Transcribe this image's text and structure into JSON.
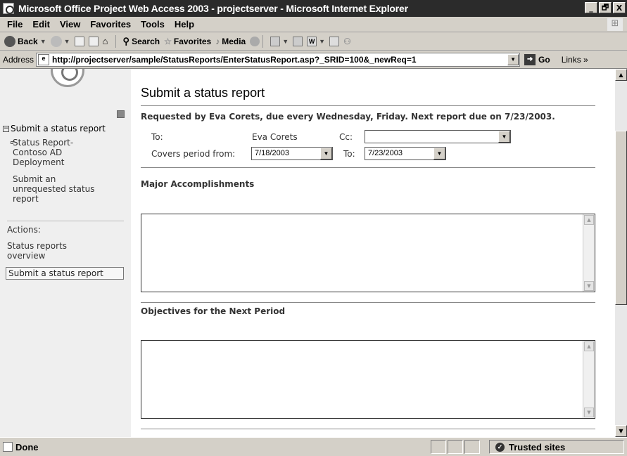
{
  "window": {
    "title": "Microsoft Office Project Web Access 2003 - projectserver - Microsoft Internet Explorer",
    "buttons": [
      "_",
      "🗗",
      "X"
    ]
  },
  "menu": [
    "File",
    "Edit",
    "View",
    "Favorites",
    "Tools",
    "Help"
  ],
  "toolbar": {
    "back": "Back",
    "search": "Search",
    "favorites": "Favorites",
    "media": "Media"
  },
  "address": {
    "label": "Address",
    "url": "http://projectserver/sample/StatusReports/EnterStatusReport.asp?_SRID=100&_newReq=1",
    "go": "Go",
    "links": "Links"
  },
  "sidebar": {
    "section_title": "Submit a status report",
    "items": [
      "Status Report-",
      "Contoso AD",
      "Deployment",
      "Submit an",
      "unrequested status",
      "report"
    ],
    "actions_label": "Actions:",
    "action_links": [
      "Status reports",
      "overview"
    ],
    "current_action": "Submit a status report"
  },
  "main": {
    "title": "Submit a status report",
    "request_info": "Requested by Eva Corets, due every Wednesday, Friday. Next report due on 7/23/2003.",
    "to_label": "To:",
    "to_value": "Eva Corets",
    "cc_label": "Cc:",
    "cc_value": "",
    "period_label": "Covers period from:",
    "from_date": "7/18/2003",
    "to2_label": "To:",
    "to_date": "7/23/2003",
    "sections": [
      "Major Accomplishments",
      "Objectives for the Next Period"
    ],
    "accomplishments_text": "",
    "objectives_text": ""
  },
  "status": {
    "text": "Done",
    "zone": "Trusted sites"
  }
}
